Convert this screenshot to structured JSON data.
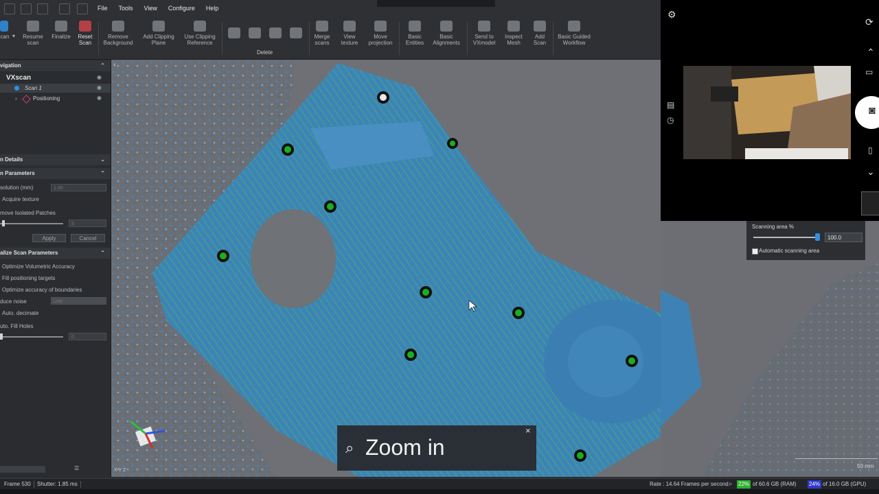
{
  "menu": [
    "File",
    "Tools",
    "View",
    "Configure",
    "Help"
  ],
  "ribbon": {
    "left_buttons": [
      {
        "label": "can",
        "state": "active"
      },
      {
        "label": "Resume\nscan"
      },
      {
        "label": "Finalize"
      },
      {
        "label": "Reset\nScan",
        "state": "highlight"
      }
    ],
    "buttons": [
      {
        "label": "Remove\nBackground"
      },
      {
        "label": "Add Clipping\nPlane"
      },
      {
        "label": "Use Clipping\nReference"
      },
      {
        "label": "Merge\nscans"
      },
      {
        "label": "View\ntexture"
      },
      {
        "label": "Move\nprojection"
      },
      {
        "label": "Basic\nEntities"
      },
      {
        "label": "Basic\nAlignments"
      },
      {
        "label": "Send to\nVXmodel"
      },
      {
        "label": "Inspect\nMesh"
      },
      {
        "label": "Add\nScan"
      },
      {
        "label": "Basic Guided\nWorkflow"
      }
    ],
    "delete_group_label": "Delete"
  },
  "navigation": {
    "header": "vigation",
    "root": "VXscan",
    "scan": "Scan 1",
    "positioning": "Positioning"
  },
  "scan_details": {
    "header": "n Details"
  },
  "scan_parameters": {
    "header": "n Parameters",
    "resolution_label": "solution (mm)",
    "resolution_value": "1.00",
    "acquire_texture": "Acquire texture",
    "remove_isolated": "move Isolated Patches",
    "remove_isolated_value": "5",
    "apply": "Apply",
    "cancel": "Cancel"
  },
  "finalize_parameters": {
    "header": "alize Scan Parameters",
    "optimize_volumetric": "Optimize Volumetric Accuracy",
    "fill_targets": "Fill positioning targets",
    "optimize_boundaries": "Optimize accuracy of boundaries",
    "reduce_noise_label": "duce noise",
    "reduce_noise_value": "Low",
    "auto_decimate": "Auto. decimate",
    "auto_fill": "uto. Fill Holes",
    "auto_fill_value": "0"
  },
  "scanning_area": {
    "label": "Scanning area %",
    "value": "100.0",
    "level_percent": 100,
    "automatic_label": "Automatic scanning area"
  },
  "viewport": {
    "axis_label": "X Y Z",
    "scale_label": "50 mm"
  },
  "zoom_toast": {
    "text": "Zoom in",
    "close": "×"
  },
  "status": {
    "frame": "Frame 530",
    "shutter": "Shutter: 1.85 ms",
    "rate": "Rate : 14.64 Frames per second",
    "ram_percent": "22%",
    "ram_text": "of 60.6 GB (RAM)",
    "gpu_percent": "24%",
    "gpu_text": "of 16.0 GB (GPU)"
  },
  "colors": {
    "accent": "#2f8fe3",
    "part_blue": "#3f86b8",
    "target_green": "#19b01f",
    "ram_green": "#2bb02d",
    "gpu_blue": "#2d39c9",
    "reset_red": "#c9434a"
  }
}
